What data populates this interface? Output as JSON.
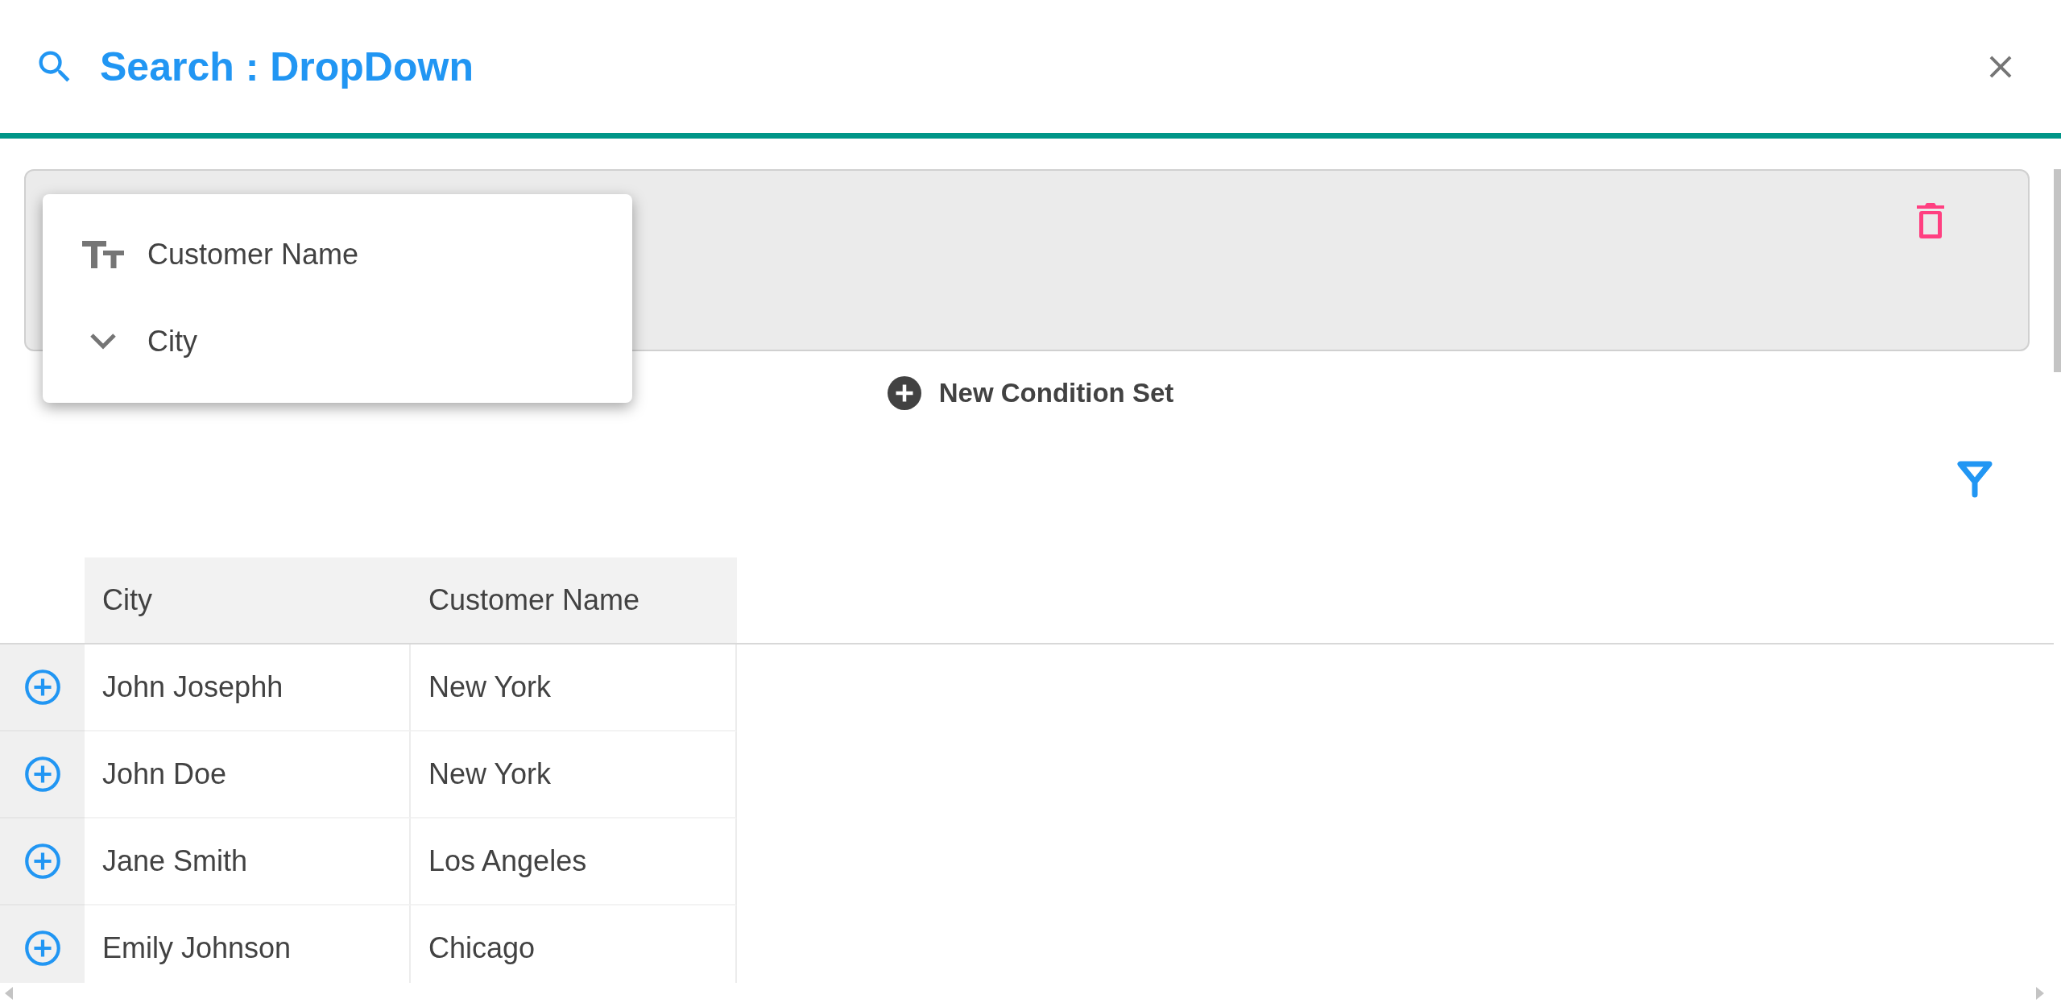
{
  "dialog": {
    "title": "Search : DropDown"
  },
  "field_menu": {
    "items": [
      {
        "kind": "text",
        "label": "Customer Name"
      },
      {
        "kind": "dropdown",
        "label": "City"
      }
    ]
  },
  "new_condition_button": {
    "label": "New Condition Set"
  },
  "table": {
    "columns": [
      "City",
      "Customer Name"
    ],
    "rows": [
      [
        "John Josephh",
        "New York"
      ],
      [
        "John Doe",
        "New York"
      ],
      [
        "Jane Smith",
        "Los Angeles"
      ],
      [
        "Emily Johnson",
        "Chicago"
      ]
    ]
  }
}
